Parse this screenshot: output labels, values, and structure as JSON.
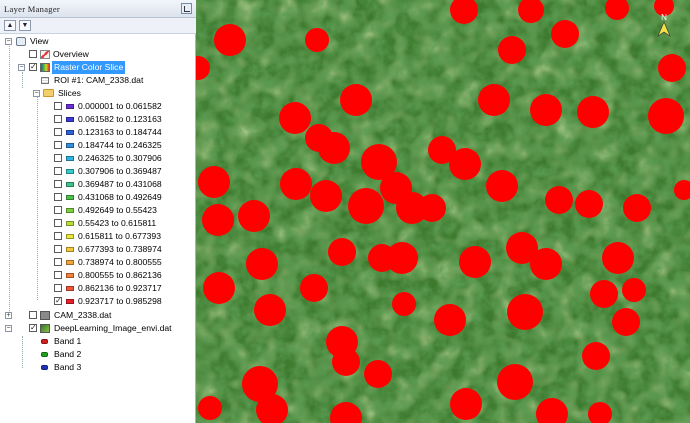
{
  "panel": {
    "title": "Layer Manager",
    "pin_icon": "pin-icon",
    "toolbar": {
      "expand_icon": "arrow-up-icon",
      "collapse_icon": "arrow-down-icon"
    }
  },
  "tree": {
    "root": "View",
    "overview": "Overview",
    "raster_color_slice": "Raster Color Slice",
    "roi": "ROI #1: CAM_2338.dat",
    "slices_folder": "Slices",
    "slices": [
      {
        "label": "0.000001 to 0.061582",
        "color": "#6b2fd6",
        "checked": false
      },
      {
        "label": "0.061582 to 0.123163",
        "color": "#3b3bd9",
        "checked": false
      },
      {
        "label": "0.123163 to 0.184744",
        "color": "#2f62d9",
        "checked": false
      },
      {
        "label": "0.184744 to 0.246325",
        "color": "#2f8ee0",
        "checked": false
      },
      {
        "label": "0.246325 to 0.307906",
        "color": "#2fb4e6",
        "checked": false
      },
      {
        "label": "0.307906 to 0.369487",
        "color": "#33cccc",
        "checked": false
      },
      {
        "label": "0.369487 to 0.431068",
        "color": "#3ec28a",
        "checked": false
      },
      {
        "label": "0.431068 to 0.492649",
        "color": "#4cc24c",
        "checked": false
      },
      {
        "label": "0.492649 to 0.55423",
        "color": "#7ed13e",
        "checked": false
      },
      {
        "label": "0.55423 to 0.615811",
        "color": "#b8de3a",
        "checked": false
      },
      {
        "label": "0.615811 to 0.677393",
        "color": "#e8e63a",
        "checked": false
      },
      {
        "label": "0.677393 to 0.738974",
        "color": "#f5c83a",
        "checked": false
      },
      {
        "label": "0.738974 to 0.800555",
        "color": "#f5a43a",
        "checked": false
      },
      {
        "label": "0.800555 to 0.862136",
        "color": "#f5803a",
        "checked": false
      },
      {
        "label": "0.862136 to 0.923717",
        "color": "#f0543a",
        "checked": false
      },
      {
        "label": "0.923717 to 0.985298",
        "color": "#e8202a",
        "checked": true
      }
    ],
    "cam_layer": "CAM_2338.dat",
    "dl_layer": "DeepLearning_Image_envi.dat",
    "bands": [
      {
        "label": "Band 1",
        "color": "#d42020"
      },
      {
        "label": "Band 2",
        "color": "#20a020"
      },
      {
        "label": "Band 3",
        "color": "#2030c0"
      }
    ]
  },
  "imageview": {
    "north_arrow_label": "N",
    "highlight_color": "#ff0000"
  }
}
